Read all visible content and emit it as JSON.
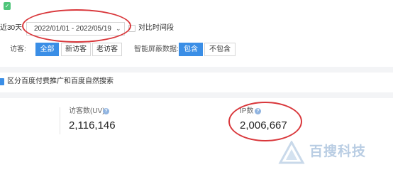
{
  "filters": {
    "recent_label": "近30天",
    "date_range": "2022/01/01 - 2022/05/19",
    "compare_label": "对比时间段",
    "visitor_label": "访客:",
    "visitor_options": [
      "全部",
      "新访客",
      "老访客"
    ],
    "visitor_selected": "全部",
    "smart_filter_label": "智能屏蔽数据:",
    "smart_options": [
      "包含",
      "不包含"
    ],
    "smart_selected": "包含"
  },
  "toggle": {
    "label": "区分百度付费推广和百度自然搜索"
  },
  "metrics": [
    {
      "label": "访客数(UV)",
      "value": "2,116,146"
    },
    {
      "label": "IP数",
      "value": "2,006,667"
    }
  ],
  "watermark": {
    "text": "百搜科技"
  },
  "colors": {
    "accent": "#3a8ee6",
    "annotation": "#d9373b",
    "green_icon": "#4fc57a",
    "watermark": "#b9cde3"
  }
}
